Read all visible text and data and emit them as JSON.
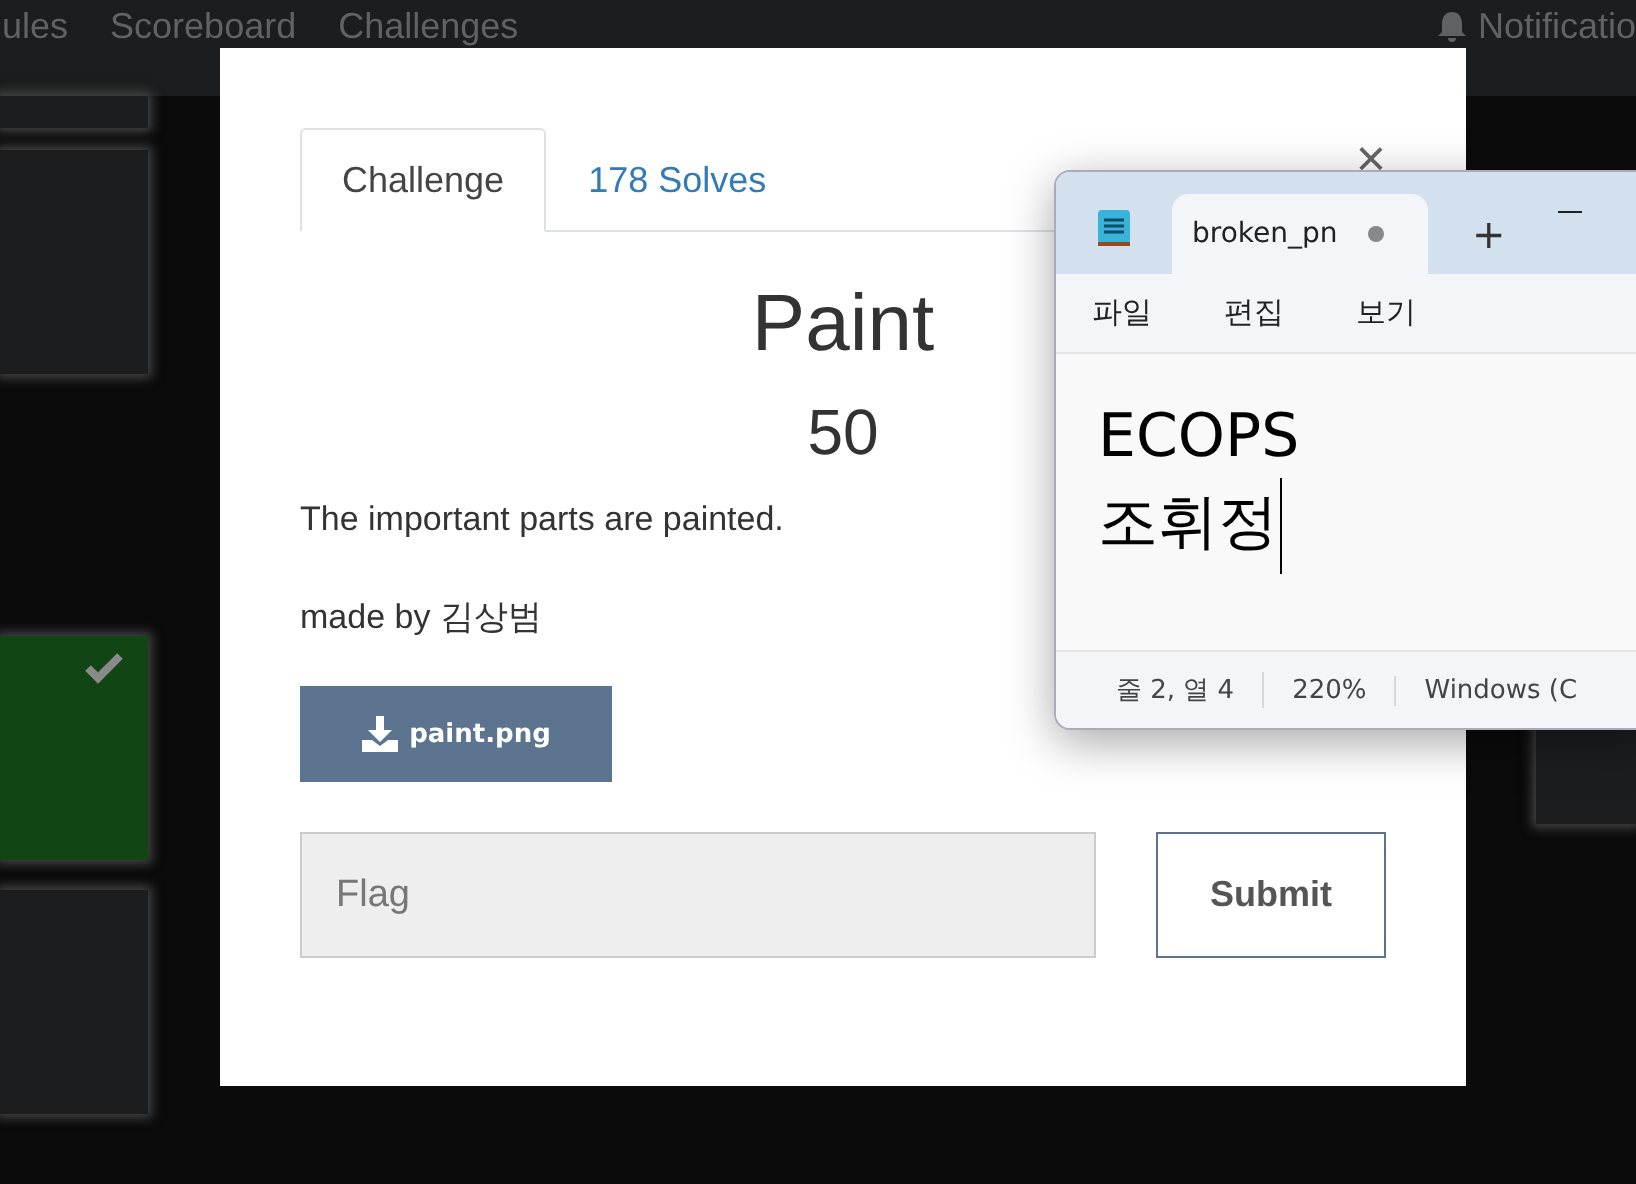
{
  "navbar": {
    "items": [
      {
        "label": "ules"
      },
      {
        "label": "Scoreboard"
      },
      {
        "label": "Challenges"
      }
    ],
    "notifications": "Notificatio"
  },
  "left_tiles": [
    {
      "solved": false
    },
    {
      "solved": false
    },
    {
      "solved": true
    },
    {
      "solved": false
    }
  ],
  "right_tiles": [
    {
      "solved": false
    }
  ],
  "modal": {
    "close": "×",
    "tabs": [
      {
        "label": "Challenge",
        "selected": true
      },
      {
        "label": "178 Solves",
        "selected": false
      }
    ],
    "title": "Paint",
    "value": "50",
    "description": "The important parts are painted.",
    "author": "made by 김상범",
    "file_button": "paint.png",
    "flag": {
      "placeholder": "Flag"
    },
    "submit": "Submit"
  },
  "notepad": {
    "tab": {
      "title": "broken_pn",
      "modified": true
    },
    "new_tab": "+",
    "menu": [
      "파일",
      "편집",
      "보기"
    ],
    "lines": [
      "ECOPS",
      "조휘정"
    ],
    "status": [
      "줄 2, 열 4",
      "220%",
      "Windows (C"
    ]
  }
}
